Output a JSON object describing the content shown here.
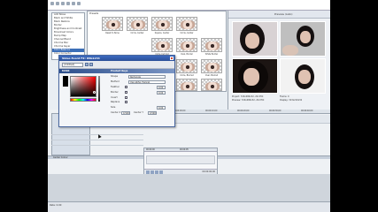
{
  "fx_list": {
    "items": [
      "Add Noise",
      "Black and White",
      "Black Restore",
      "Border",
      "Brightness and Contrast",
      "Broadcast Colors",
      "Bump Map",
      "Channel Blend",
      "Chroma Blur",
      "Chroma Keyer",
      "Color Balance",
      "Color Corrector"
    ],
    "selected_index": 10
  },
  "presets": {
    "title": "Presets",
    "thumbs": [
      {
        "label": "Reset to None"
      },
      {
        "label": "Circle, Center"
      },
      {
        "label": "Square, Center"
      },
      {
        "label": "Circle, Center"
      },
      {
        "label": "Circle Cut Out"
      },
      {
        "label": "Oval, Border"
      },
      {
        "label": "White Border"
      },
      {
        "label": "Circle, Blurred"
      },
      {
        "label": "Oval, Blurred"
      },
      {
        "label": "Top Left Portrait"
      },
      {
        "label": "Fade Border"
      },
      {
        "label": "Oval Blurred"
      }
    ]
  },
  "preview": {
    "title": "Preview (Auto)",
    "project_line": "Project: 720x480x32, 29.970i",
    "preview_line": "Preview: 720x480x32, 29.970i",
    "frame_line": "Frame: 0",
    "display_line": "Display: 313x210x32"
  },
  "dialog": {
    "title": "Video Event FX: IMG1234",
    "preset_combo": "(Untitled)",
    "subhead": "MASK",
    "subhead_right": "Product Keys",
    "params": [
      {
        "label": "Shape",
        "value": "Rectangle"
      },
      {
        "label": "Method",
        "value": "Use alpha channel"
      },
      {
        "label": "Feather",
        "value": "0.00"
      },
      {
        "label": "Border",
        "value": "0.00"
      },
      {
        "label": "Invert",
        "value": ""
      },
      {
        "label": "Replace",
        "value": ""
      },
      {
        "label": "Size",
        "value": "0.00"
      },
      {
        "label": "Center X",
        "value": "0.500"
      },
      {
        "label": "Center Y",
        "value": "0.500"
      }
    ]
  },
  "timeline": {
    "ruler_labels": [
      "00:00:00;00",
      "00:00:10;00",
      "00:00:20;00",
      "00:00:30;00",
      "00:00:40;00"
    ],
    "track_header": "Center Colour",
    "events_time": "00:00:00;00",
    "events_ruler": [
      "00:00:00",
      "00:00:05"
    ]
  },
  "status": {
    "left": "Rate: 0.00"
  }
}
